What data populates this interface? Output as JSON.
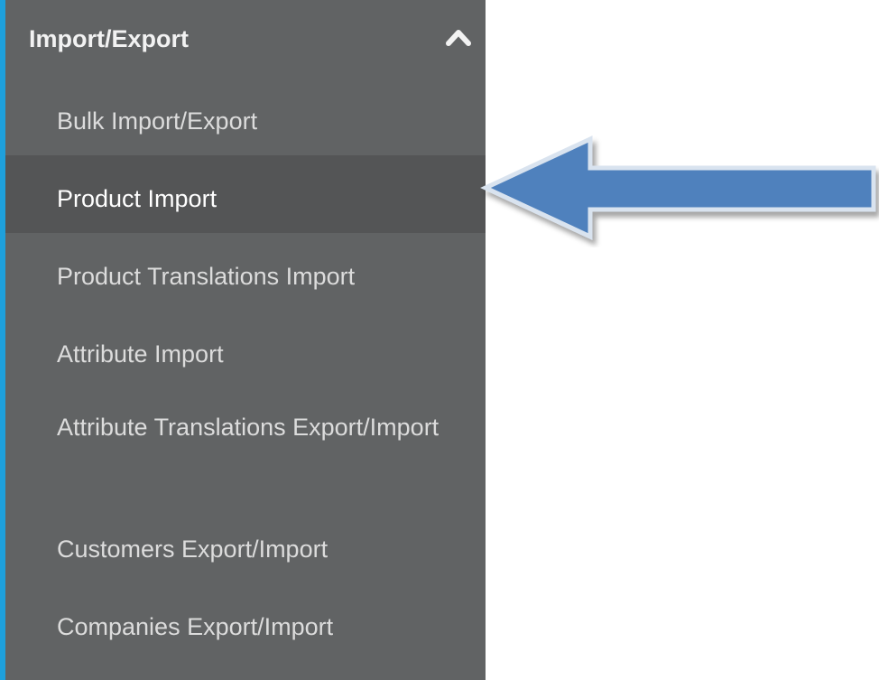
{
  "section": {
    "title": "Import/Export",
    "collapse_icon": "chevron-up-icon"
  },
  "menu": {
    "items": [
      {
        "label": "Bulk Import/Export"
      },
      {
        "label": "Product Import",
        "active": true
      },
      {
        "label": "Product Translations Import"
      },
      {
        "label": "Attribute Import"
      },
      {
        "label": "Attribute Translations Export/Import"
      },
      {
        "label": "Customers Export/Import"
      },
      {
        "label": "Companies Export/Import"
      }
    ]
  },
  "annotation": {
    "icon": "left-arrow-icon",
    "color": "#4f81bd"
  },
  "colors": {
    "sidebar_bg": "#616364",
    "active_bg": "#545556",
    "accent_border": "#1ea0dc"
  }
}
